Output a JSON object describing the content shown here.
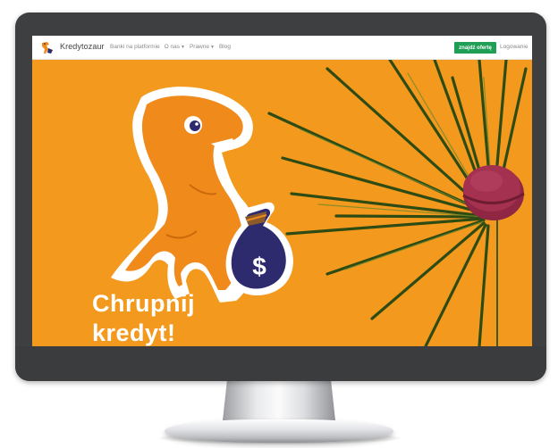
{
  "navbar": {
    "brand": "Kredytozaur",
    "links": [
      {
        "label": "Banki na platformie",
        "dropdown": false
      },
      {
        "label": "O nas",
        "dropdown": true
      },
      {
        "label": "Prawne",
        "dropdown": true
      },
      {
        "label": "Blog",
        "dropdown": false
      }
    ],
    "cta_label": "znajdź ofertę",
    "login_label": "Logowanie"
  },
  "hero": {
    "headline_line1": "Chrupnij",
    "headline_line2": "kredyt!",
    "money_bag_symbol": "$"
  },
  "colors": {
    "hero_background": "#f3991e",
    "dino": "#f08a1a",
    "cta": "#1f9e55",
    "money_bag": "#2d2a6e",
    "macaron": "#a3314f"
  },
  "icons": {
    "logo": "dino-logo-icon",
    "caret": "caret-down-icon"
  }
}
